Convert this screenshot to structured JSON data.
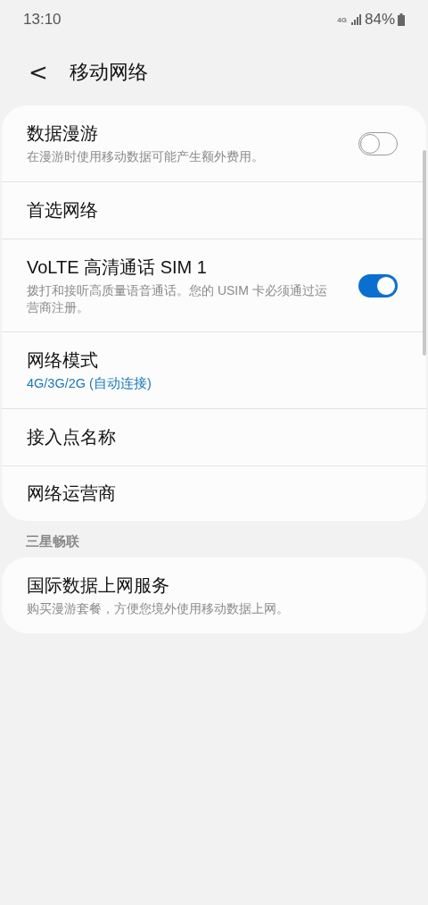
{
  "status_bar": {
    "time": "13:10",
    "network": "4G",
    "battery": "84%"
  },
  "header": {
    "back": "<",
    "title": "移动网络"
  },
  "sections": [
    {
      "items": [
        {
          "kind": "switch",
          "title": "数据漫游",
          "description": "在漫游时使用移动数据可能产生额外费用。",
          "on": false
        },
        {
          "kind": "plain",
          "title": "首选网络"
        },
        {
          "kind": "switch",
          "title": "VoLTE 高清通话 SIM 1",
          "description": "拨打和接听高质量语音通话。您的 USIM 卡必须通过运营商注册。",
          "on": true
        },
        {
          "kind": "plain",
          "title": "网络模式",
          "summary": "4G/3G/2G (自动连接)"
        },
        {
          "kind": "plain",
          "title": "接入点名称"
        },
        {
          "kind": "plain",
          "title": "网络运营商"
        }
      ]
    },
    {
      "heading": "三星畅联",
      "items": [
        {
          "kind": "plain",
          "title": "国际数据上网服务",
          "description": "购买漫游套餐，方便您境外使用移动数据上网。"
        }
      ]
    }
  ]
}
